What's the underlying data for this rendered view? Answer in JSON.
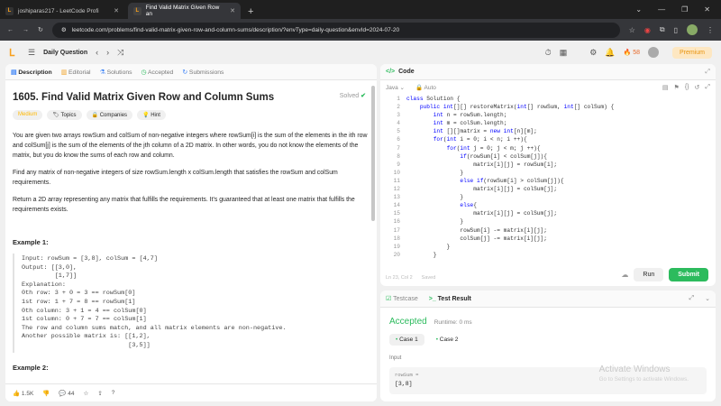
{
  "browser": {
    "tabs": [
      {
        "title": "joshiparas217 - LeetCode Profi",
        "active": false
      },
      {
        "title": "Find Valid Matrix Given Row an",
        "active": true
      }
    ],
    "url": "leetcode.com/problems/find-valid-matrix-given-row-and-column-sums/description/?envType=daily-question&envId=2024-07-20"
  },
  "lc_nav": {
    "title": "Daily Question",
    "streak": "58",
    "premium": "Premium"
  },
  "left_tabs": [
    "Description",
    "Editorial",
    "Solutions",
    "Accepted",
    "Submissions"
  ],
  "problem": {
    "title": "1605. Find Valid Matrix Given Row and Column Sums",
    "solved": "Solved",
    "difficulty": "Medium",
    "pills": [
      "Topics",
      "Companies",
      "Hint"
    ],
    "para1": "You are given two arrays rowSum and colSum of non-negative integers where rowSum[i] is the sum of the elements in the ith row and colSum[j] is the sum of the elements of the jth column of a 2D matrix. In other words, you do not know the elements of the matrix, but you do know the sums of each row and column.",
    "para2": "Find any matrix of non-negative integers of size rowSum.length x colSum.length that satisfies the rowSum and colSum requirements.",
    "para3": "Return a 2D array representing any matrix that fulfills the requirements. It's guaranteed that at least one matrix that fulfills the requirements exists.",
    "example1_title": "Example 1:",
    "example1": "Input: rowSum = [3,8], colSum = [4,7]\nOutput: [[3,0],\n         [1,7]]\nExplanation:\n0th row: 3 + 0 = 3 == rowSum[0]\n1st row: 1 + 7 = 8 == rowSum[1]\n0th column: 3 + 1 = 4 == colSum[0]\n1st column: 0 + 7 = 7 == colSum[1]\nThe row and column sums match, and all matrix elements are non-negative.\nAnother possible matrix is: [[1,2],\n                             [3,5]]",
    "example2_title": "Example 2:"
  },
  "footer": {
    "likes": "1.5K",
    "comments": "44"
  },
  "code_panel": {
    "title": "Code",
    "lang": "Java",
    "auto": "Auto",
    "line_numbers": "1\n2\n3\n4\n5\n6\n7\n8\n9\n10\n11\n12\n13\n14\n15\n16\n17\n18\n19\n20",
    "status_pos": "Ln 23, Col 2",
    "status_saved": "Saved",
    "run": "Run",
    "submit": "Submit"
  },
  "result_panel": {
    "tabs": [
      "Testcase",
      "Test Result"
    ],
    "status": "Accepted",
    "runtime": "Runtime: 0 ms",
    "cases": [
      "Case 1",
      "Case 2"
    ],
    "input_label": "Input",
    "input_var": "rowSum =",
    "input_val": "[3,8]"
  },
  "watermark": {
    "title": "Activate Windows",
    "sub": "Go to Settings to activate Windows."
  }
}
